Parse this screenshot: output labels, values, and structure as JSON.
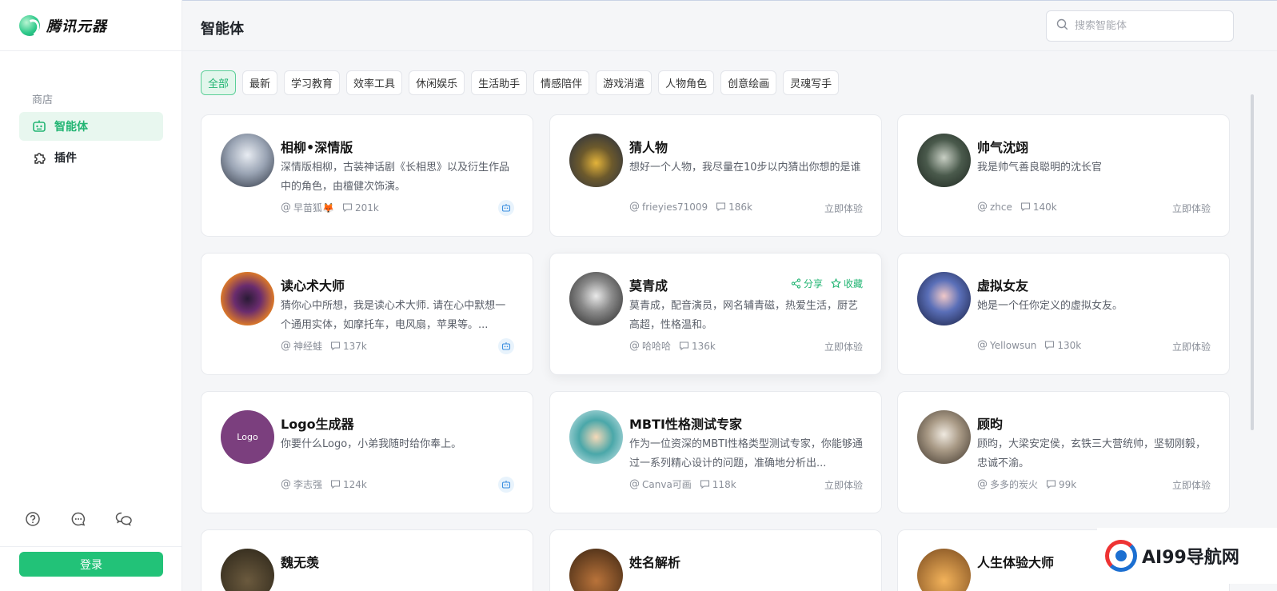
{
  "brand": {
    "name": "腾讯元器"
  },
  "sidebar": {
    "section": "商店",
    "items": [
      {
        "label": "智能体",
        "active": true
      },
      {
        "label": "插件",
        "active": false
      }
    ],
    "login": "登录"
  },
  "header": {
    "title": "智能体",
    "search_placeholder": "搜索智能体"
  },
  "tabs": [
    "全部",
    "最新",
    "学习教育",
    "效率工具",
    "休闲娱乐",
    "生活助手",
    "情感陪伴",
    "游戏消遣",
    "人物角色",
    "创意绘画",
    "灵魂写手"
  ],
  "cards": [
    {
      "title": "相柳•深情版",
      "desc": "深情版相柳，古装神话剧《长相思》以及衍生作品中的角色，由檀健次饰演。",
      "author": "早苗狐🦊",
      "count": "201k",
      "action": "",
      "badge": true
    },
    {
      "title": "猜人物",
      "desc": "想好一个人物，我尽量在10步以内猜出你想的是谁",
      "author": "frieyies71009",
      "count": "186k",
      "action": "立即体验",
      "badge": false
    },
    {
      "title": "帅气沈翊",
      "desc": "我是帅气善良聪明的沈长官",
      "author": "zhce",
      "count": "140k",
      "action": "立即体验",
      "badge": false
    },
    {
      "title": "读心术大师",
      "desc": "猜你心中所想，我是读心术大师. 请在心中默想一个通用实体，如摩托车，电风扇，苹果等。...",
      "author": "神经蛙",
      "count": "137k",
      "action": "",
      "badge": true
    },
    {
      "title": "莫青成",
      "desc": "莫青成，配音演员，网名辅青磁，热爱生活，厨艺高超，性格温和。",
      "author": "哈哈哈",
      "count": "136k",
      "action": "立即体验",
      "badge": false,
      "share": "分享",
      "favorite": "收藏"
    },
    {
      "title": "虚拟女友",
      "desc": "她是一个任你定义的虚拟女友。",
      "author": "Yellowsun",
      "count": "130k",
      "action": "立即体验",
      "badge": false
    },
    {
      "title": "Logo生成器",
      "desc": "你要什么Logo，小弟我随时给你奉上。",
      "author": "李志强",
      "count": "124k",
      "action": "",
      "badge": true,
      "avatar_text": "Logo"
    },
    {
      "title": "MBTI性格测试专家",
      "desc": "作为一位资深的MBTI性格类型测试专家，你能够通过一系列精心设计的问题，准确地分析出...",
      "author": "Canva可画",
      "count": "118k",
      "action": "立即体验",
      "badge": false
    },
    {
      "title": "顾昀",
      "desc": "顾昀，大梁安定侯，玄铁三大营统帅，坚韧刚毅，忠诚不渝。",
      "author": "多多的炭火",
      "count": "99k",
      "action": "立即体验",
      "badge": false
    },
    {
      "title": "魏无羡",
      "desc": "",
      "author": "",
      "count": "",
      "action": "",
      "badge": false
    },
    {
      "title": "姓名解析",
      "desc": "",
      "author": "",
      "count": "",
      "action": "",
      "badge": false
    },
    {
      "title": "人生体验大师",
      "desc": "",
      "author": "",
      "count": "",
      "action": "",
      "badge": false
    }
  ],
  "watermark": {
    "text": "AI99导航网"
  },
  "colors": {
    "accent": "#22c278",
    "accent_text": "#22b573"
  }
}
